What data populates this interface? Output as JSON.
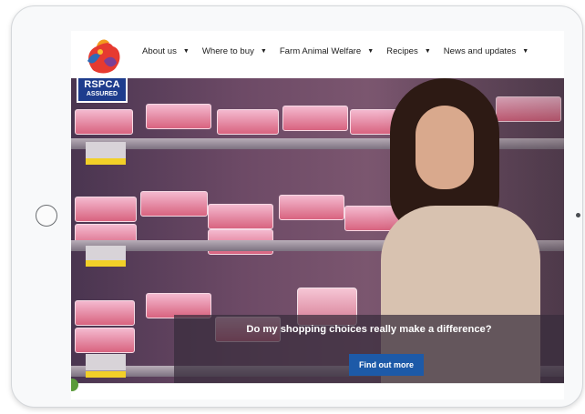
{
  "brand": {
    "logo_line1": "RSPCA",
    "logo_line2": "ASSURED"
  },
  "nav": {
    "items": [
      {
        "label": "About us"
      },
      {
        "label": "Where to buy"
      },
      {
        "label": "Farm Animal Welfare"
      },
      {
        "label": "Recipes"
      },
      {
        "label": "News and updates"
      }
    ],
    "caret_icon": "caret-down-icon"
  },
  "hero": {
    "headline": "Do my shopping choices really make a difference?",
    "cta_label": "Find out more"
  },
  "colors": {
    "brand_blue": "#1e3c8d",
    "cta_blue": "#1d5aa8",
    "price_tag_yellow": "#f2d028"
  }
}
